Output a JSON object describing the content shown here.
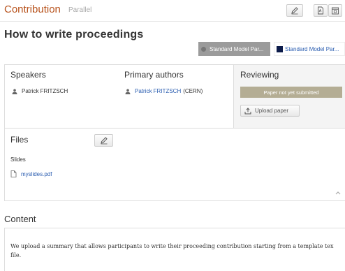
{
  "header": {
    "section_label": "Contribution",
    "track_label": "Parallel",
    "buttons": {
      "edit_icon": "pencil-icon",
      "pdf_icon": "pdf-icon",
      "calendar_icon": "calendar-icon"
    }
  },
  "contribution": {
    "title": "How to write proceedings",
    "tags": [
      {
        "label": "Standard Model Par...",
        "color": "#9b9b9b"
      },
      {
        "label": "Standard Model Par...",
        "color": "#0c1b4a"
      }
    ]
  },
  "speakers": {
    "heading": "Speakers",
    "items": [
      {
        "name": "Patrick FRITZSCH"
      }
    ]
  },
  "primary_authors": {
    "heading": "Primary authors",
    "items": [
      {
        "name": "Patrick FRITZSCH",
        "affiliation": "(CERN)"
      }
    ]
  },
  "reviewing": {
    "heading": "Reviewing",
    "status": "Paper not yet submitted",
    "upload_label": "Upload paper"
  },
  "files": {
    "heading": "Files",
    "groups": [
      {
        "label": "Slides",
        "items": [
          {
            "filename": "myslides.pdf"
          }
        ]
      }
    ]
  },
  "content": {
    "heading": "Content",
    "text": "We upload a summary that allows participants to write their proceeding contribution starting from a template tex file."
  }
}
